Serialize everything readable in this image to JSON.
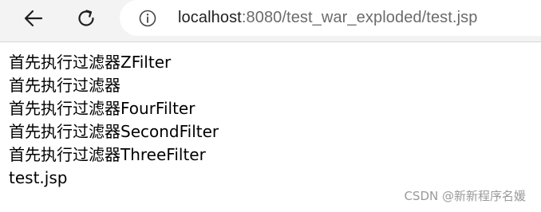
{
  "browser": {
    "back_icon": "arrow-left-icon",
    "reload_icon": "reload-icon",
    "info_icon": "info-circle-icon",
    "url_host": "localhost",
    "url_rest": ":8080/test_war_exploded/test.jsp"
  },
  "page": {
    "lines": [
      "首先执行过滤器ZFilter",
      "首先执行过滤器",
      "首先执行过滤器FourFilter",
      "首先执行过滤器SecondFilter",
      "首先执行过滤器ThreeFilter",
      "test.jsp"
    ]
  },
  "watermark": "CSDN @新新程序名媛",
  "colors": {
    "toolbar_bg": "#f3f3f3",
    "address_bg": "#ffffff",
    "text": "#000000",
    "watermark": "#9a9a9a"
  }
}
